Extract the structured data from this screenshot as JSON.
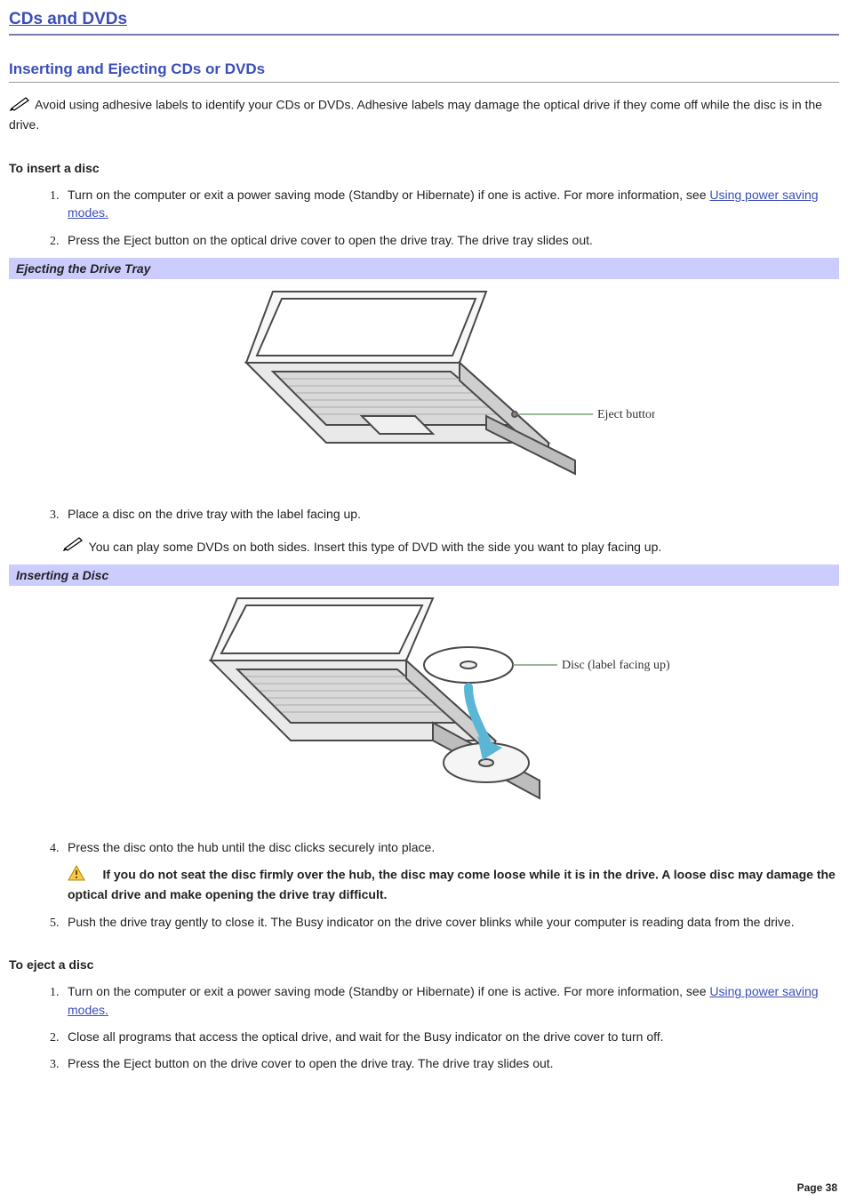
{
  "page": {
    "title": "CDs and DVDs",
    "section_title": "Inserting and Ejecting CDs or DVDs",
    "footer_label": "Page 38"
  },
  "notes": {
    "adhesive_warning": "Avoid using adhesive labels to identify your CDs or DVDs. Adhesive labels may damage the optical drive if they come off while the disc is in the drive.",
    "dvd_both_sides": "You can play some DVDs on both sides. Insert this type of DVD with the side you want to play facing up.",
    "seat_disc_warning": "If you do not seat the disc firmly over the hub, the disc may come loose while it is in the drive. A loose disc may damage the optical drive and make opening the drive tray difficult."
  },
  "subheads": {
    "insert": "To insert a disc",
    "eject": "To eject a disc"
  },
  "captions": {
    "eject_tray": "Ejecting the Drive Tray",
    "insert_disc": "Inserting a Disc"
  },
  "figure_labels": {
    "eject_button": "Eject button",
    "disc_label_up": "Disc (label facing up)"
  },
  "links": {
    "power_saving": "Using power saving modes."
  },
  "insert_steps": {
    "s1_pre": "Turn on the computer or exit a power saving mode (Standby or Hibernate) if one is active. For more information, see ",
    "s2": "Press the Eject button on the optical drive cover to open the drive tray. The drive tray slides out.",
    "s3": "Place a disc on the drive tray with the label facing up.",
    "s4": "Press the disc onto the hub until the disc clicks securely into place.",
    "s5": "Push the drive tray gently to close it. The Busy indicator on the drive cover blinks while your computer is reading data from the drive."
  },
  "eject_steps": {
    "s1_pre": "Turn on the computer or exit a power saving mode (Standby or Hibernate) if one is active. For more information, see ",
    "s2": "Close all programs that access the optical drive, and wait for the Busy indicator on the drive cover to turn off.",
    "s3": "Press the Eject button on the drive cover to open the drive tray. The drive tray slides out."
  }
}
